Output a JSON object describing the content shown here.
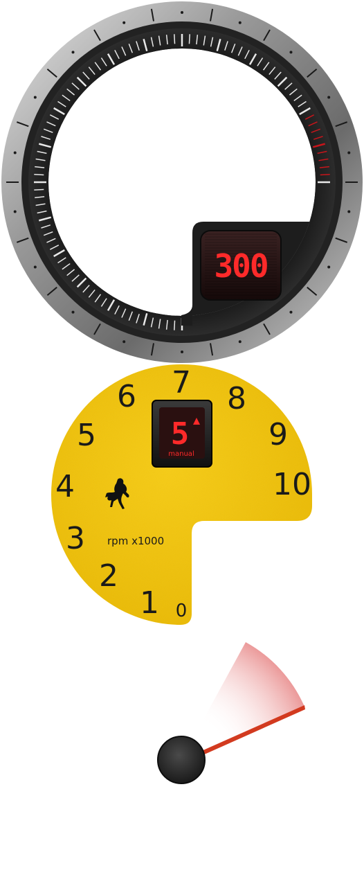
{
  "speed_display": "300",
  "gear": {
    "value": "5",
    "direction_icon": "up-arrow-icon",
    "mode_label": "manual"
  },
  "tachometer": {
    "numbers": [
      "0",
      "1",
      "2",
      "3",
      "4",
      "5",
      "6",
      "7",
      "8",
      "9",
      "10"
    ],
    "unit_label": "rpm x1000",
    "logo_icon": "prancing-horse-icon"
  },
  "colors": {
    "dial_yellow": "#f2c200",
    "lcd_red": "#ff2a2a",
    "redline": "#c8151b",
    "needle": "#d23a1f"
  }
}
